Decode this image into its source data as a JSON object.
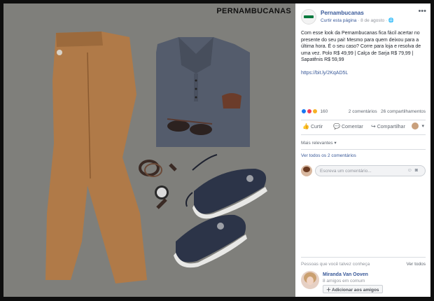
{
  "photo": {
    "brand": "PERNAMBUCANAS"
  },
  "post": {
    "page_name": "Pernambucanas",
    "like_page": "Curtir esta página",
    "date": "8 de agosto",
    "privacy_icon": "globe-icon",
    "text": "Com esse look da Pernambucanas fica fácil acertar no presente do seu pai! Mesmo para quem deixou para a última hora. É o seu caso? Corre para loja e resolva de uma vez. Polo R$ 49,99 | Calça de Sarja R$ 79,99 | Sapatênis R$ 59,99",
    "link": "https://bit.ly/2KqAD5L"
  },
  "reactions": {
    "count": "160",
    "comments": "2 comentários",
    "shares": "26 compartilhamentos",
    "colors": {
      "like": "#1877f2",
      "love": "#f33e58",
      "wow": "#f7b125"
    }
  },
  "actions": {
    "like": "Curtir",
    "comment": "Comentar",
    "share": "Compartilhar"
  },
  "comments": {
    "sort": "Mais relevantes",
    "view_more": "Ver todos os 2 comentários",
    "placeholder": "Escreva um comentário..."
  },
  "pymk": {
    "title": "Pessoas que você talvez conheça",
    "see_all": "Ver todos",
    "name": "Miranda Van Ooven",
    "mutual": "8 amigos em comum",
    "add_button": "Adicionar aos amigos"
  }
}
